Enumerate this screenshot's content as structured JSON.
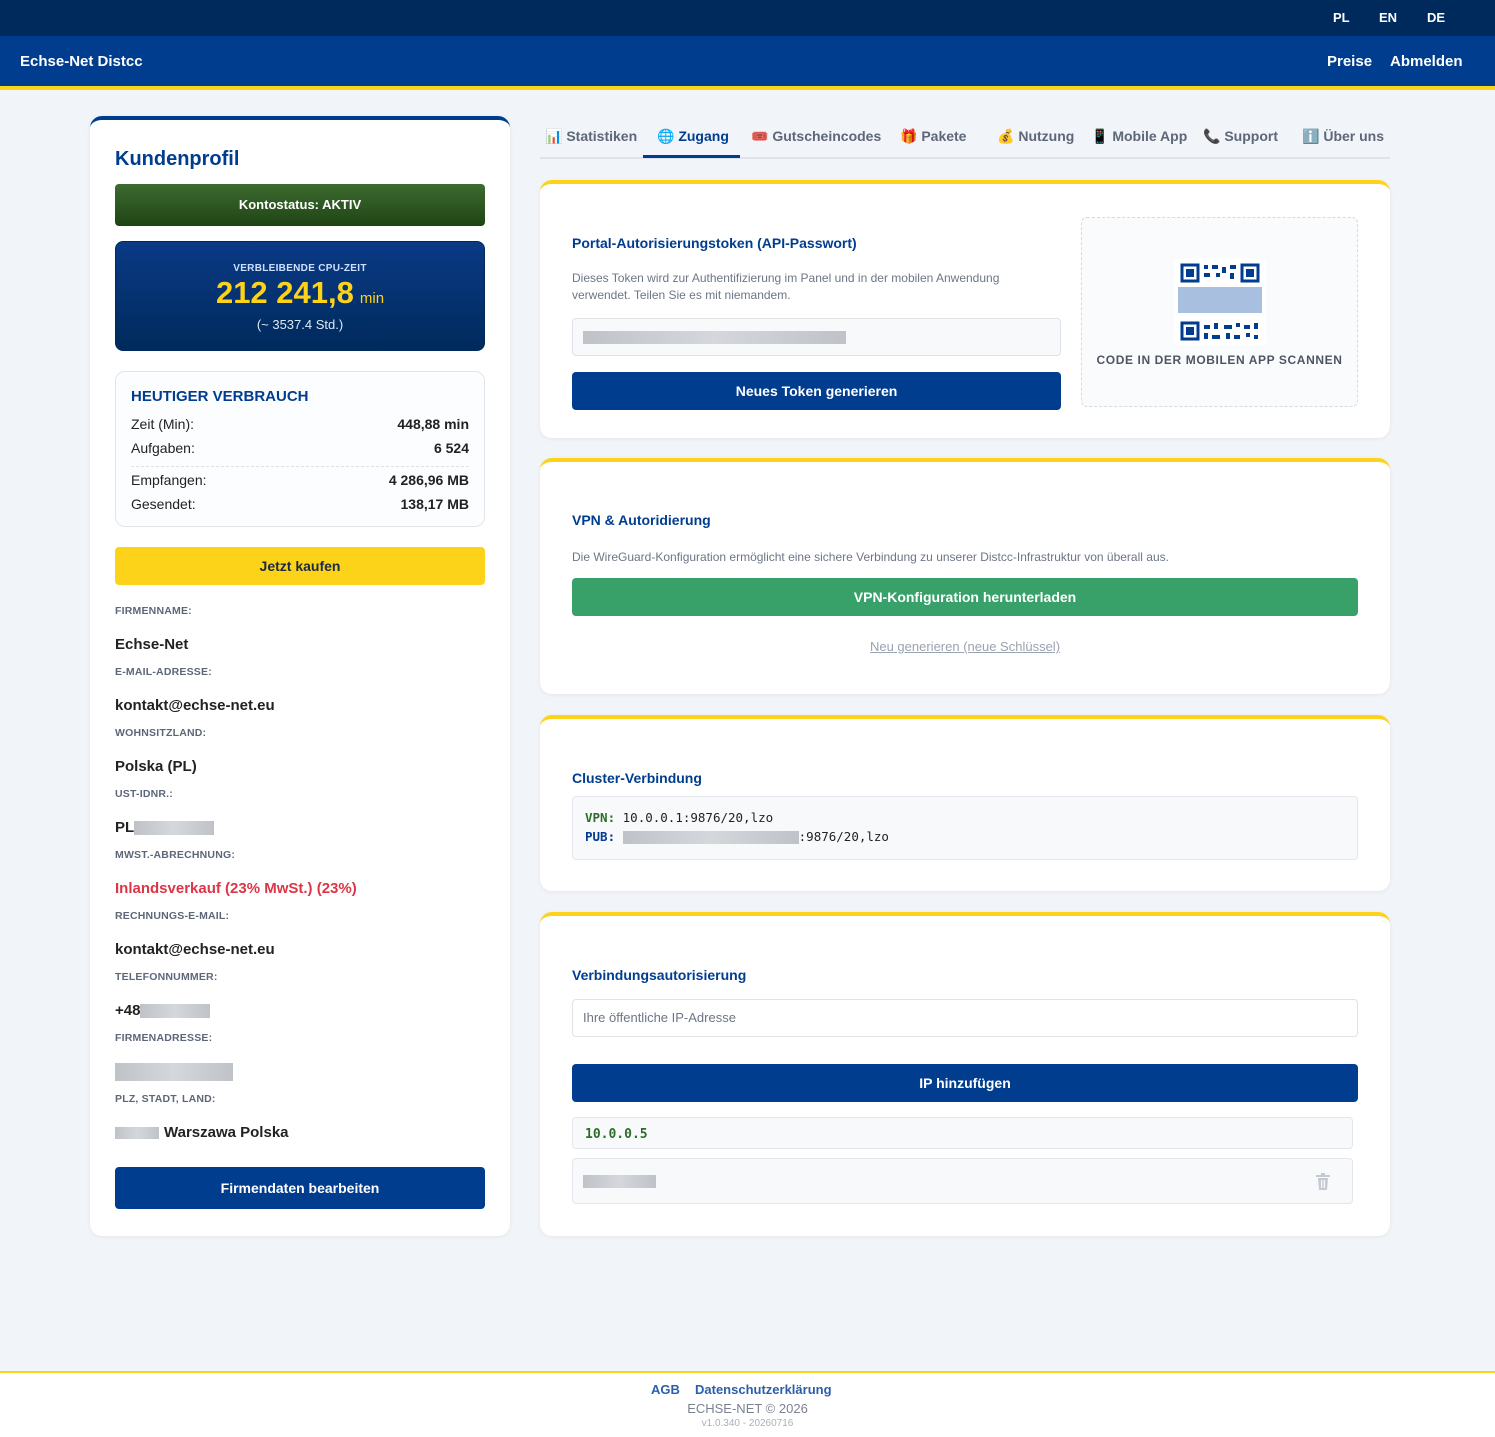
{
  "languages": [
    "PL",
    "EN",
    "DE"
  ],
  "brand": "Echse-Net Distcc",
  "nav": {
    "pricing": "Preise",
    "logout": "Abmelden"
  },
  "profile": {
    "title": "Kundenprofil",
    "account_status": "Kontostatus: AKTIV",
    "cpu_label": "VERBLEIBENDE CPU-ZEIT",
    "cpu_value": "212 241,8",
    "cpu_unit": "min",
    "cpu_hours": "(~ 3537.4 Std.)",
    "usage": {
      "title": "HEUTIGER VERBRAUCH",
      "time_label": "Zeit (Min):",
      "time_value": "448,88 min",
      "tasks_label": "Aufgaben:",
      "tasks_value": "6 524",
      "received_label": "Empfangen:",
      "received_value": "4 286,96 MB",
      "sent_label": "Gesendet:",
      "sent_value": "138,17 MB"
    },
    "buy_button": "Jetzt kaufen",
    "fields": {
      "company_label": "FIRMENNAME:",
      "company_value": "Echse-Net",
      "email_label": "E-MAIL-ADRESSE:",
      "email_value": "kontakt@echse-net.eu",
      "country_label": "WOHNSITZLAND:",
      "country_value": "Polska (PL)",
      "vat_label": "UST-IDNR.:",
      "vat_prefix": "PL",
      "vat_calc_label": "MWST.-ABRECHNUNG:",
      "vat_calc_value": "Inlandsverkauf (23% MwSt.) (23%)",
      "billing_email_label": "RECHNUNGS-E-MAIL:",
      "billing_email_value": "kontakt@echse-net.eu",
      "phone_label": "TELEFONNUMMER:",
      "phone_prefix": "+48",
      "address_label": "FIRMENADRESSE:",
      "city_label": "PLZ, STADT, LAND:",
      "city_value": "Warszawa Polska"
    },
    "edit_button": "Firmendaten bearbeiten"
  },
  "tabs": [
    {
      "icon": "📊",
      "label": "Statistiken"
    },
    {
      "icon": "🌐",
      "label": "Zugang"
    },
    {
      "icon": "🎟️",
      "label": "Gutscheincodes"
    },
    {
      "icon": "🎁",
      "label": "Pakete"
    },
    {
      "icon": "💰",
      "label": "Nutzung"
    },
    {
      "icon": "📱",
      "label": "Mobile App"
    },
    {
      "icon": "📞",
      "label": "Support"
    },
    {
      "icon": "ℹ️",
      "label": "Über uns"
    }
  ],
  "active_tab": "Zugang",
  "token": {
    "title": "Portal-Autorisierungstoken (API-Passwort)",
    "description": "Dieses Token wird zur Authentifizierung im Panel und in der mobilen Anwendung verwendet. Teilen Sie es mit niemandem.",
    "generate_button": "Neues Token generieren",
    "qr_caption": "CODE IN DER MOBILEN APP SCANNEN"
  },
  "vpn": {
    "title": "VPN & Autoridierung",
    "description": "Die WireGuard-Konfiguration ermöglicht eine sichere Verbindung zu unserer Distcc-Infrastruktur von überall aus.",
    "download_button": "VPN-Konfiguration herunterladen",
    "regenerate_link": "Neu generieren (neue Schlüssel)"
  },
  "cluster": {
    "title": "Cluster-Verbindung",
    "vpn_key": "VPN:",
    "vpn_value": "10.0.0.1:9876/20,lzo",
    "pub_key": "PUB:",
    "pub_suffix": ":9876/20,lzo"
  },
  "auth": {
    "title": "Verbindungsautorisierung",
    "ip_placeholder": "Ihre öffentliche IP-Adresse",
    "add_button": "IP hinzufügen",
    "ips": [
      "10.0.0.5"
    ]
  },
  "footer": {
    "terms": "AGB",
    "privacy": "Datenschutzerklärung",
    "copyright": "ECHSE-NET © 2026",
    "version": "v1.0.340 - 20260716"
  },
  "colors": {
    "primary": "#003d8f",
    "accent": "#fdd31a",
    "success": "#38a169",
    "danger": "#dc3545"
  }
}
